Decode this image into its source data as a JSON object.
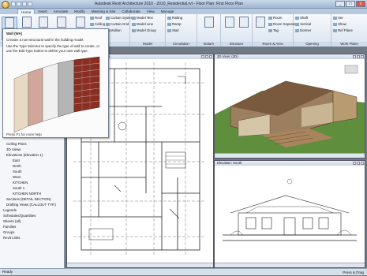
{
  "app": {
    "title": "Autodesk Revit Architecture 2010 - 2010_Residential.rvt - Floor Plan: First Floor Plan"
  },
  "tabs": [
    "Home",
    "Insert",
    "Annotate",
    "Modify",
    "Massing & Site",
    "Collaborate",
    "View",
    "Manage"
  ],
  "ribbon": {
    "build": {
      "buttons": [
        "Wall",
        "Door",
        "Window",
        "Component",
        "Column"
      ],
      "small": [
        "Roof",
        "Ceiling",
        "Floor",
        "Curtain System",
        "Curtain Grid",
        "Mullion"
      ],
      "label": "Build"
    },
    "model": {
      "small": [
        "Model Text",
        "Model Line",
        "Model Group"
      ],
      "label": "Model"
    },
    "circulation": {
      "small": [
        "Railing",
        "Ramp",
        "Stair"
      ],
      "label": "Circulation"
    },
    "room_area": {
      "small": [
        "Room",
        "Room Separator",
        "Tag"
      ],
      "label": "Room & Area"
    },
    "work_plane": {
      "small": [
        "Set",
        "Show",
        "Ref Plane"
      ],
      "label": "Work Plane"
    },
    "datum": {
      "label": "Datum"
    },
    "structure": {
      "label": "Structure"
    },
    "opening": {
      "small": [
        "Shaft",
        "Vertical",
        "Dormer"
      ],
      "label": "Opening"
    }
  },
  "tooltip": {
    "title": "Wall (WA)",
    "desc1": "Creates a non-structural wall in the building model.",
    "desc2": "Use the Type Selector to specify the type of wall to create, or",
    "desc3": "use the Edit Type button to define your own wall type.",
    "help": "Press F1 for more help"
  },
  "tree": [
    "Ceiling Plans",
    "3D Views",
    "Elevations (Elevation 1)",
    "East",
    "North",
    "South",
    "West",
    "KITCHEN",
    "South 1",
    "KITCHEN NORTH",
    "Sections (DETAIL SECTION)",
    "Drafting Views (CALLOUT TYP.)",
    "Legends",
    "Schedules/Quantities",
    "Sheets (all)",
    "Families",
    "Groups",
    "Revit Links"
  ],
  "views": {
    "plan": "Floor Plan: First Floor Plan",
    "persp": "3D View: {3D}",
    "elev": "Elevation: South"
  },
  "status": {
    "text": "Ready",
    "right": "Press & Drag"
  }
}
